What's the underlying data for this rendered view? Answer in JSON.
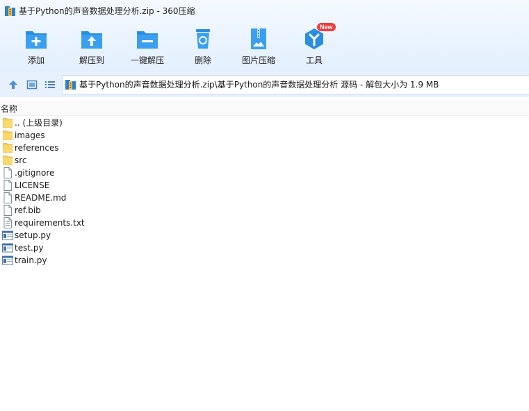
{
  "window": {
    "title": "基于Python的声音数据处理分析.zip - 360压缩"
  },
  "toolbar": {
    "items": [
      {
        "label": "添加",
        "icon": "add-icon"
      },
      {
        "label": "解压到",
        "icon": "extract-to-icon"
      },
      {
        "label": "一键解压",
        "icon": "one-click-extract-icon"
      },
      {
        "label": "删除",
        "icon": "delete-icon"
      },
      {
        "label": "图片压缩",
        "icon": "image-compress-icon"
      },
      {
        "label": "工具",
        "icon": "tools-icon",
        "badge": "New"
      }
    ]
  },
  "address": {
    "path": "基于Python的声音数据处理分析.zip\\基于Python的声音数据处理分析 源码 - 解包大小为 1.9 MB"
  },
  "columns": {
    "name": "名称"
  },
  "files": [
    {
      "name": ".. (上级目录)",
      "type": "folder"
    },
    {
      "name": "images",
      "type": "folder"
    },
    {
      "name": "references",
      "type": "folder"
    },
    {
      "name": "src",
      "type": "folder"
    },
    {
      "name": ".gitignore",
      "type": "file"
    },
    {
      "name": "LICENSE",
      "type": "file"
    },
    {
      "name": "README.md",
      "type": "file"
    },
    {
      "name": "ref.bib",
      "type": "file"
    },
    {
      "name": "requirements.txt",
      "type": "text"
    },
    {
      "name": "setup.py",
      "type": "script"
    },
    {
      "name": "test.py",
      "type": "script"
    },
    {
      "name": "train.py",
      "type": "script"
    }
  ],
  "colors": {
    "accent": "#2a8ee0",
    "toolbar_bg": "#e9f3fe",
    "badge": "#f23b3b",
    "folder": "#f6cf5e"
  }
}
